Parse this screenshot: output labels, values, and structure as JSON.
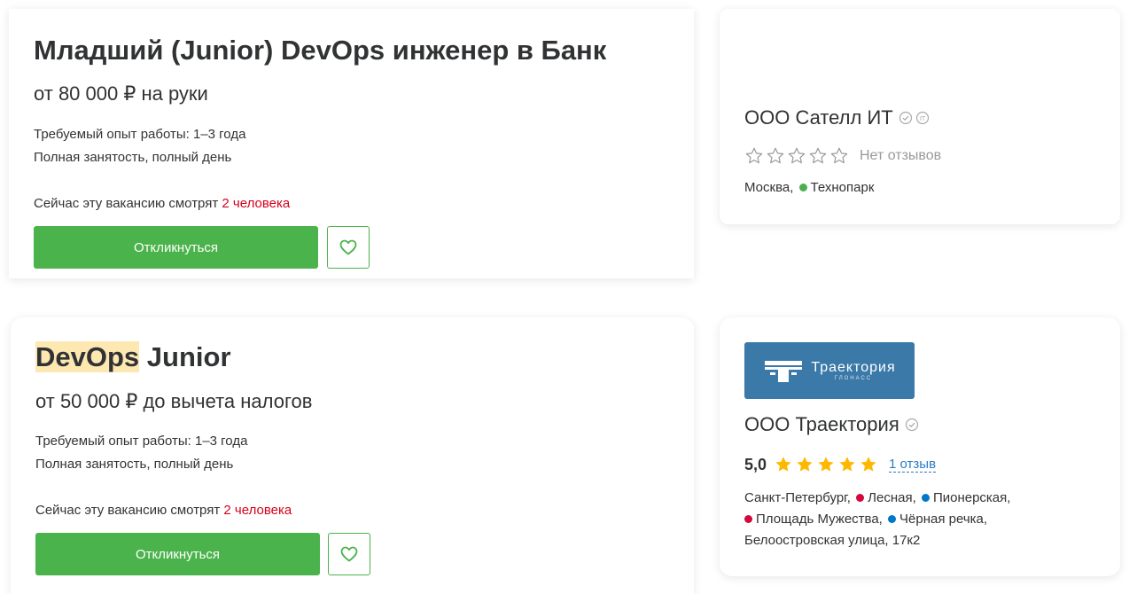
{
  "vacancies": [
    {
      "title": "Младший (Junior) DevOps инженер в Банк",
      "salary": "от 80 000 ₽ на руки",
      "experience": "Требуемый опыт работы: 1–3 года",
      "employment": "Полная занятость, полный день",
      "watching_prefix": "Сейчас эту вакансию смотрят ",
      "watching_count": "2 человека",
      "apply_label": "Откликнуться"
    },
    {
      "title_highlight": "DevOps",
      "title_rest": " Junior",
      "salary": "от 50 000 ₽ до вычета налогов",
      "experience": "Требуемый опыт работы: 1–3 года",
      "employment": "Полная занятость, полный день",
      "watching_prefix": "Сейчас эту вакансию смотрят ",
      "watching_count": "2 человека",
      "apply_label": "Откликнуться"
    }
  ],
  "employers": [
    {
      "name": "ООО Сателл ИТ",
      "rating_stars": 0,
      "no_reviews": "Нет отзывов",
      "city": "Москва, ",
      "metro": [
        {
          "name": "Технопарк",
          "color": "#4caf50"
        }
      ]
    },
    {
      "name": "ООО Траектория",
      "logo_text": "Траектория",
      "logo_sub": "ГЛОНАСС",
      "logo_bg": "#3b79a8",
      "rating": "5,0",
      "rating_stars": 5,
      "reviews": "1 отзыв",
      "city": "Санкт-Петербург, ",
      "metro": [
        {
          "name": "Лесная, ",
          "color": "#d6083b"
        },
        {
          "name": "Пионерская,",
          "color": "#0078c9"
        },
        {
          "name": "Площадь Мужества, ",
          "color": "#d6083b"
        },
        {
          "name": "Чёрная речка,",
          "color": "#0078c9"
        }
      ],
      "street": "Белоостровская улица, 17к2"
    }
  ],
  "colors": {
    "accent": "#4bb34b",
    "count_red": "#d6001c",
    "star_gold": "#ffb800",
    "link": "#2b7bc6",
    "highlight": "#fde8b2"
  },
  "icons": [
    "heart-icon",
    "verified-check-icon",
    "it-badge-icon",
    "star-icon"
  ]
}
